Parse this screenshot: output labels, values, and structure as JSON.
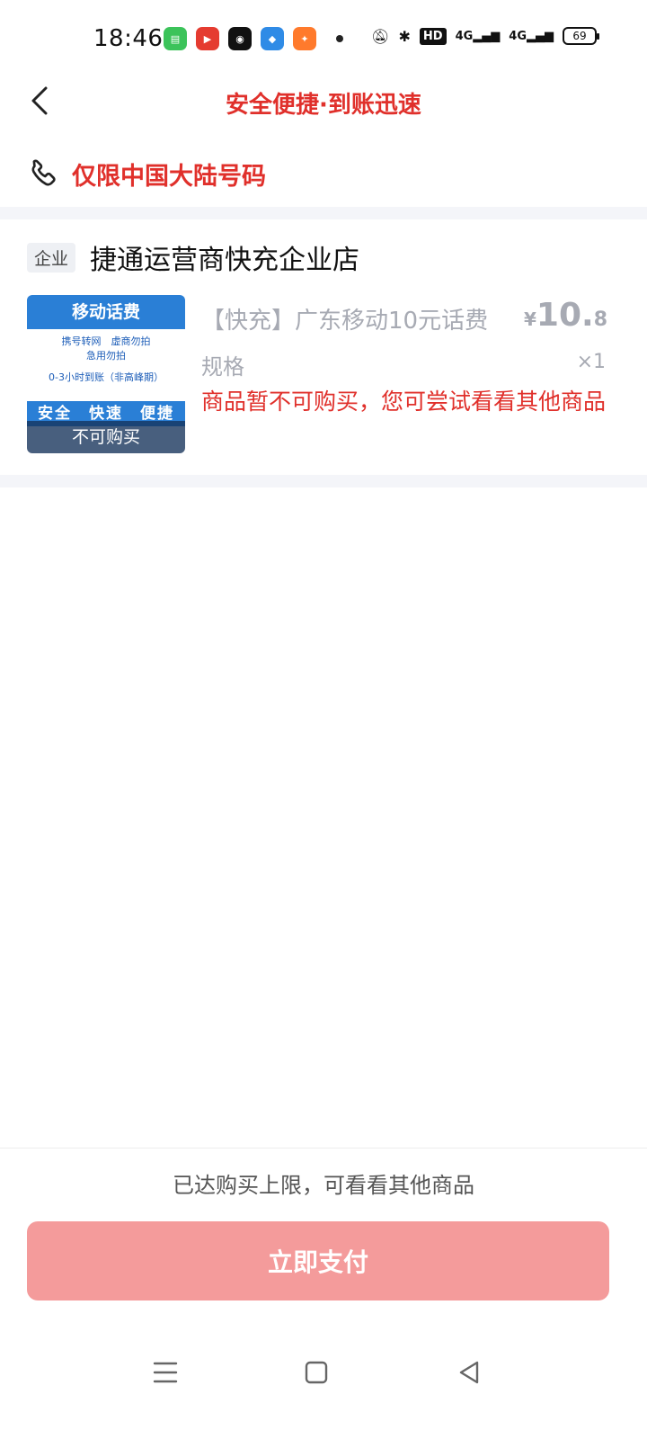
{
  "status_bar": {
    "time": "18:46",
    "notification_app_icons": [
      "messages-icon",
      "video-app-icon",
      "wechat-icon",
      "browser-icon",
      "shopping-icon"
    ],
    "hd_label": "HD",
    "network_1": "4G",
    "network_2": "4G",
    "battery": "69"
  },
  "header": {
    "title": "安全便捷·到账迅速"
  },
  "notice": {
    "text": "仅限中国大陆号码"
  },
  "store": {
    "badge": "企业",
    "name": "捷通运营商快充企业店"
  },
  "product": {
    "thumb_title": "移动话费",
    "thumb_line1": "携号转网　虚商勿拍",
    "thumb_line2": "急用勿拍",
    "thumb_line3": "0-3小时到账（非高峰期）",
    "thumb_strip": "安全　快速　便捷",
    "thumb_overlay": "不可购买",
    "title": "【快充】广东移动10元话费",
    "price_currency": "¥",
    "price_int": "10.",
    "price_dec": "8",
    "spec_label": "规格",
    "quantity": "×1",
    "unavailable_msg": "商品暂不可购买，您可尝试看看其他商品"
  },
  "footer": {
    "limit_text": "已达购买上限，可看看其他商品",
    "pay_label": "立即支付"
  },
  "colors": {
    "accent_red": "#e0302b",
    "pay_button": "#f49b9b",
    "muted_text": "#a7aab3"
  }
}
